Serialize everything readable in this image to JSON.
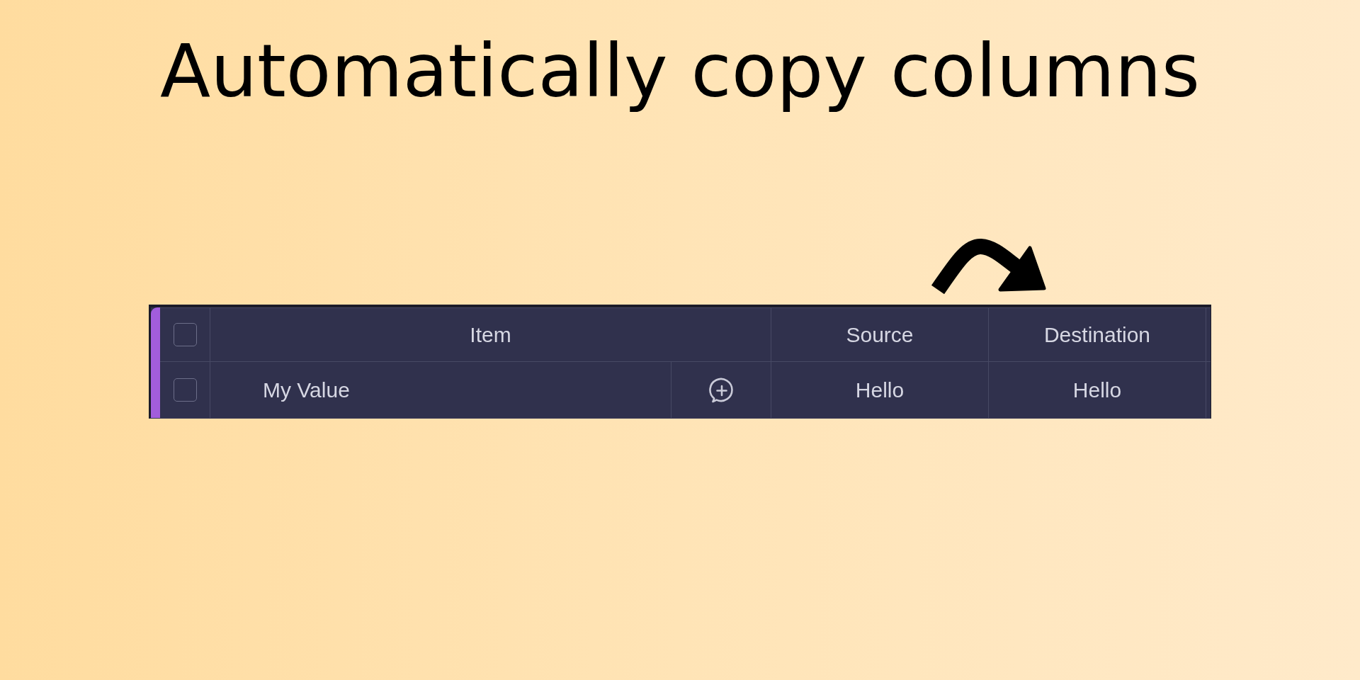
{
  "title": "Automatically copy columns",
  "table": {
    "header_checkbox": {
      "checked": false
    },
    "columns": [
      {
        "label": "Item"
      },
      {
        "label": "Source"
      },
      {
        "label": "Destination"
      }
    ],
    "rows": [
      {
        "checked": false,
        "cells": [
          "My Value",
          "Hello",
          "Hello"
        ]
      }
    ]
  }
}
